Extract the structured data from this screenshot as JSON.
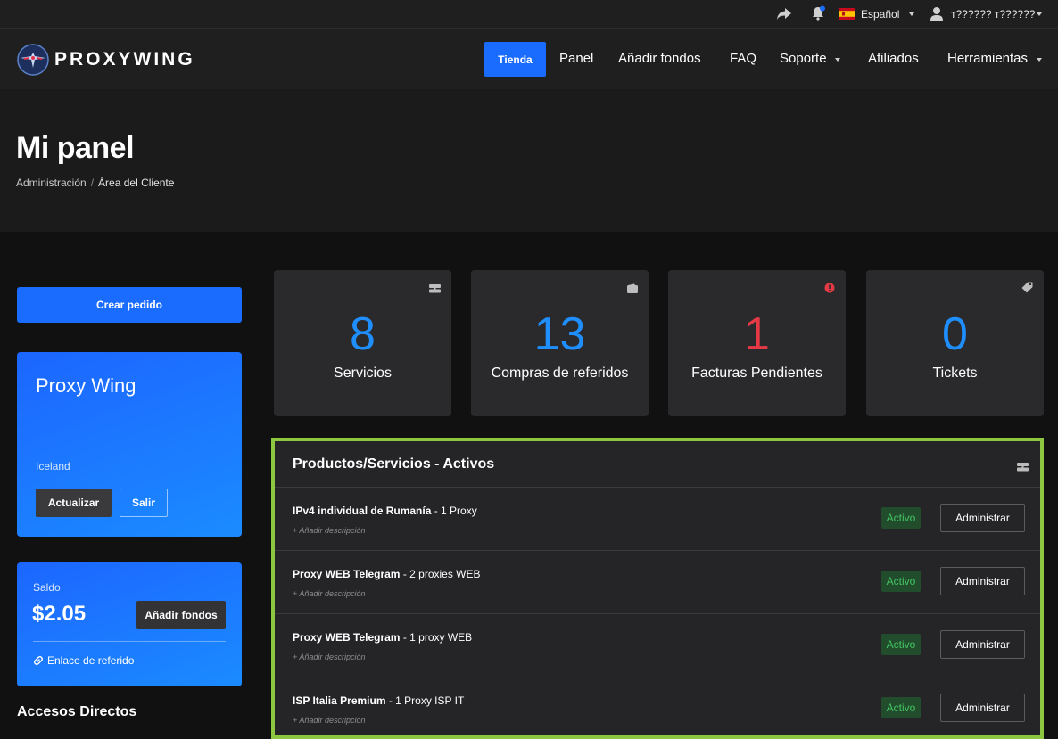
{
  "topbar": {
    "language": "Español",
    "user": "т?????? т??????",
    "icons": [
      "share-icon",
      "bell-icon",
      "spain-flag-icon",
      "user-icon"
    ],
    "notification_color": "#1a6cff"
  },
  "brand": {
    "name": "PROXYWING"
  },
  "nav": {
    "active": "Tienda",
    "items": [
      "Panel",
      "Añadir fondos",
      "FAQ",
      "Soporte",
      "Afiliados",
      "Herramientas"
    ]
  },
  "page": {
    "title": "Mi panel",
    "breadcrumb": [
      "Administración",
      "Área del Cliente"
    ]
  },
  "sidebar": {
    "create_order": "Crear pedido",
    "profile": {
      "name": "Proxy Wing",
      "location": "Iceland",
      "update_label": "Actualizar",
      "logout_label": "Salir"
    },
    "balance": {
      "label": "Saldo",
      "amount": "$2.05",
      "add_funds_label": "Añadir fondos",
      "referral_link": "Enlace de referido"
    },
    "shortcuts_title": "Accesos Directos"
  },
  "stats": [
    {
      "value": "8",
      "label": "Servicios",
      "icon": "server-icon",
      "color": "#1f8fff"
    },
    {
      "value": "13",
      "label": "Compras de referidos",
      "icon": "wallet-icon",
      "color": "#1f8fff"
    },
    {
      "value": "1",
      "label": "Facturas Pendientes",
      "icon": "alert-icon",
      "color": "#e63946"
    },
    {
      "value": "0",
      "label": "Tickets",
      "icon": "tag-icon",
      "color": "#1f8fff"
    }
  ],
  "products": {
    "title": "Productos/Servicios - Activos",
    "highlight_color": "#8dc63f",
    "rows": [
      {
        "name": "IPv4 individual de Rumanía",
        "detail": " - 1 Proxy",
        "desc": "+ Añadir descripción",
        "status": "Activo",
        "action": "Administrar"
      },
      {
        "name": "Proxy WEB Telegram",
        "detail": " - 2 proxies WEB",
        "desc": "+ Añadir descripción",
        "status": "Activo",
        "action": "Administrar"
      },
      {
        "name": "Proxy WEB Telegram",
        "detail": " - 1 proxy WEB",
        "desc": "+ Añadir descripción",
        "status": "Activo",
        "action": "Administrar"
      },
      {
        "name": "ISP Italia Premium",
        "detail": " - 1 Proxy ISP IT",
        "desc": "+ Añadir descripción",
        "status": "Activo",
        "action": "Administrar"
      }
    ]
  }
}
